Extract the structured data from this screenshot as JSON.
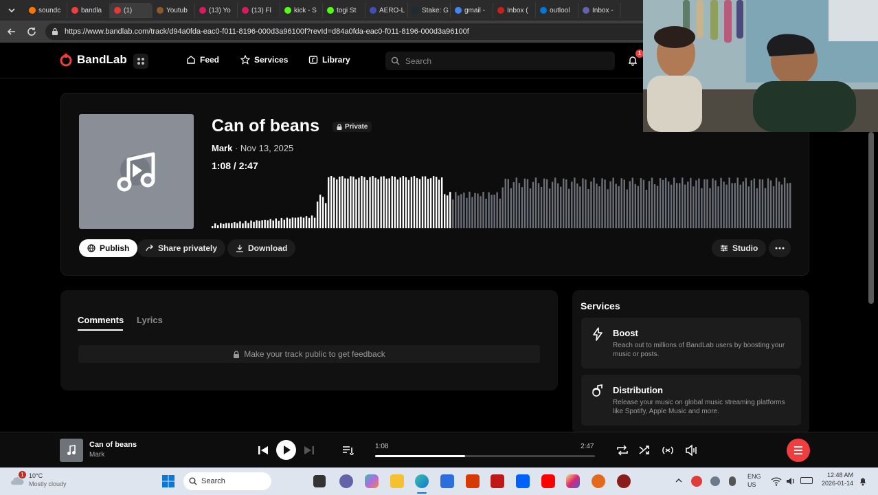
{
  "browser": {
    "tabs": [
      {
        "label": "soundc",
        "color": "#ff7700"
      },
      {
        "label": "bandla",
        "color": "#f03e3e"
      },
      {
        "label": "(1)",
        "color": "#e53935",
        "active": true
      },
      {
        "label": "Youtub",
        "color": "#8b5a2b"
      },
      {
        "label": "(13) Yo",
        "color": "#d81b60"
      },
      {
        "label": "(13) Fl",
        "color": "#d81b60"
      },
      {
        "label": "kick - S",
        "color": "#53fc18"
      },
      {
        "label": "togi St",
        "color": "#53fc18"
      },
      {
        "label": "AERO-L",
        "color": "#3f51b5"
      },
      {
        "label": "Stake: G",
        "color": "#1a2c38"
      },
      {
        "label": "gmail -",
        "color": "#4285f4"
      },
      {
        "label": "Inbox (",
        "color": "#c5221f"
      },
      {
        "label": "outlool",
        "color": "#0078d4"
      },
      {
        "label": "Inbox -",
        "color": "#6264a7"
      }
    ],
    "url": "https://www.bandlab.com/track/d94a0fda-eac0-f011-8196-000d3a96100f?revId=d84a0fda-eac0-f011-8196-000d3a96100f"
  },
  "nav": {
    "logo": "BandLab",
    "feed": "Feed",
    "services": "Services",
    "library": "Library",
    "search_placeholder": "Search",
    "notif_count": "1"
  },
  "track": {
    "title": "Can of beans",
    "privacy": "Private",
    "artist": "Mark",
    "date": " · Nov 13, 2025",
    "current": "1:08",
    "duration": "2:47",
    "played_fraction": 0.41,
    "actions": {
      "publish": "Publish",
      "share": "Share privately",
      "download": "Download",
      "studio": "Studio"
    }
  },
  "comments": {
    "tab_comments": "Comments",
    "tab_lyrics": "Lyrics",
    "locked_message": "Make your track public to get feedback"
  },
  "services": {
    "title": "Services",
    "items": [
      {
        "name": "Boost",
        "desc": "Reach out to millions of BandLab users by boosting your music or posts."
      },
      {
        "name": "Distribution",
        "desc": "Release your music on global music streaming platforms like Spotify, Apple Music and more."
      }
    ]
  },
  "player": {
    "title": "Can of beans",
    "artist": "Mark",
    "current": "1:08",
    "duration": "2:47",
    "progress": 0.41
  },
  "taskbar": {
    "temp": "10°C",
    "weather": "Mostly cloudy",
    "weather_badge": "1",
    "search": "Search",
    "lang": "ENG",
    "region": "US",
    "time": "12:48 AM",
    "date": "2026-01-14"
  },
  "colors": {
    "brand": "#f03e3e",
    "wave_played": "#ffffff",
    "wave_unplayed": "#6b6f77"
  }
}
